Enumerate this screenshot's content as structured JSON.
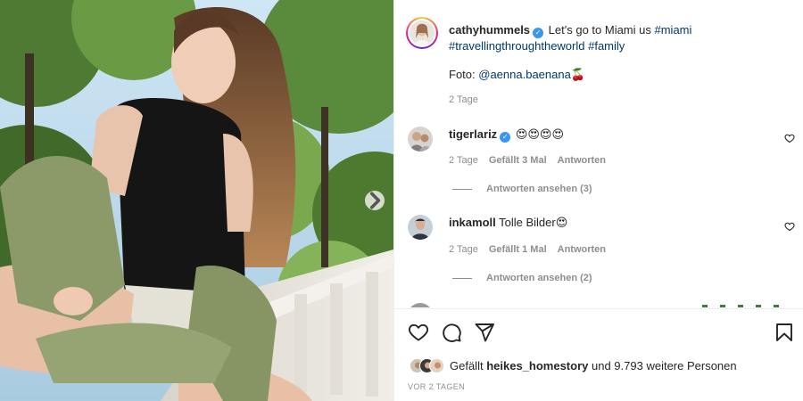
{
  "post": {
    "author": "cathyhummels",
    "caption_text": "Let's go to Miami us",
    "hashtags": [
      "#miami",
      "#travellingthroughtheworld",
      "#family"
    ],
    "photo_credit_label": "Foto:",
    "photo_credit_handle": "@aenna.baenana",
    "photo_credit_emoji": "🍒",
    "time": "2 Tage"
  },
  "comments": [
    {
      "user": "tigerlariz",
      "verified": true,
      "text": "😍😍😍😍",
      "time": "2 Tage",
      "likes": "Gefällt 3 Mal",
      "reply_label": "Antworten",
      "view_replies": "Antworten ansehen (3)"
    },
    {
      "user": "inkamoll",
      "verified": false,
      "text": "Tolle Bilder",
      "emoji": "😍",
      "time": "2 Tage",
      "likes": "Gefällt 1 Mal",
      "reply_label": "Antworten",
      "view_replies": "Antworten ansehen (2)"
    }
  ],
  "likes_bar": {
    "prefix": "Gefällt",
    "liked_by": "heikes_homestory",
    "suffix": "und 9.793 weitere Personen"
  },
  "timestamp": "VOR 2 TAGEN",
  "icons": [
    "heart-icon",
    "comment-icon",
    "share-icon",
    "bookmark-icon",
    "chevron-right-icon",
    "verified-badge-icon"
  ],
  "colors": {
    "link": "#00376b",
    "verified": "#3897f0",
    "muted": "#8e8e8e",
    "text": "#262626"
  }
}
